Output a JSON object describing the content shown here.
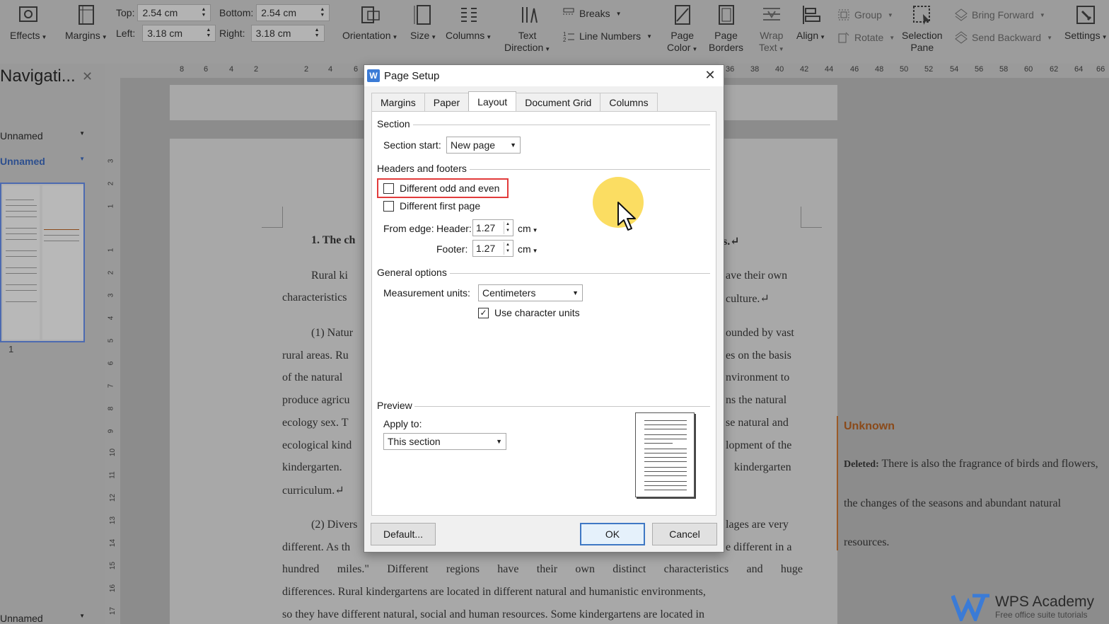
{
  "ribbon": {
    "effects": "Effects",
    "margins": "Margins",
    "top_label": "Top:",
    "top_value": "2.54 cm",
    "bottom_label": "Bottom:",
    "bottom_value": "2.54 cm",
    "left_label": "Left:",
    "left_value": "3.18 cm",
    "right_label": "Right:",
    "right_value": "3.18 cm",
    "orientation": "Orientation",
    "size": "Size",
    "columns": "Columns",
    "text_direction_1": "Text",
    "text_direction_2": "Direction",
    "breaks": "Breaks",
    "line_numbers": "Line Numbers",
    "page_color_1": "Page",
    "page_color_2": "Color",
    "page_borders_1": "Page",
    "page_borders_2": "Borders",
    "wrap_text_1": "Wrap",
    "wrap_text_2": "Text",
    "align": "Align",
    "group": "Group",
    "rotate": "Rotate",
    "selection_pane_1": "Selection",
    "selection_pane_2": "Pane",
    "bring_forward": "Bring Forward",
    "send_backward": "Send Backward",
    "settings": "Settings"
  },
  "ruler": {
    "left_ticks": [
      "8",
      "6",
      "4",
      "2",
      "2",
      "4",
      "6"
    ],
    "right_ticks": [
      "36",
      "38",
      "40",
      "42",
      "44",
      "46",
      "48",
      "50",
      "52",
      "54",
      "56",
      "58",
      "60",
      "62",
      "64",
      "66"
    ]
  },
  "vruler": {
    "ticks": [
      "3",
      "2",
      "1",
      "1",
      "2",
      "3",
      "4",
      "5",
      "6",
      "7",
      "8",
      "9",
      "10",
      "11",
      "12",
      "13",
      "14",
      "15",
      "16",
      "17"
    ]
  },
  "nav": {
    "title": "Navigati...",
    "items": [
      "Unnamed",
      "Unnamed"
    ],
    "bottom_item": "Unnamed",
    "page_number": "1"
  },
  "document": {
    "heading_left": "1. The ch",
    "heading_right": "s.↵",
    "lines_left": [
      "Rural ki",
      "characteristics",
      "(1) Natur",
      "rural areas. Ru",
      "of the natural",
      "produce agricu",
      "ecology sex. T",
      "ecological kind",
      "kindergarten.",
      "curriculum.↵",
      "(2) Divers",
      "different. As th"
    ],
    "lines_right": [
      "ave their own",
      "culture.↵",
      "ounded by vast",
      "es on the basis",
      "nvironment to",
      "ns the natural",
      "se natural and",
      "lopment of the",
      "kindergarten",
      "lages are very",
      "e different in a"
    ],
    "full_lines": [
      "hundred miles.\" Different regions have their own distinct characteristics and huge",
      "differences. Rural kindergartens are located in different natural and humanistic environments,",
      "so they have different natural, social and human resources. Some kindergartens are located in"
    ]
  },
  "comment": {
    "author": "Unknown",
    "deleted_label": "Deleted:",
    "text": "There is also the fragrance of birds and flowers, the changes of the seasons and abundant natural resources."
  },
  "watermark": {
    "brand": "WPS Academy",
    "tagline": "Free office suite tutorials"
  },
  "dialog": {
    "title": "Page Setup",
    "app_icon": "W",
    "tabs": [
      "Margins",
      "Paper",
      "Layout",
      "Document Grid",
      "Columns"
    ],
    "active_tab": "Layout",
    "section": {
      "label": "Section",
      "start_label": "Section start:",
      "start_value": "New page"
    },
    "headers_footers": {
      "label": "Headers and footers",
      "odd_even": "Different odd and even",
      "odd_even_checked": false,
      "first_page": "Different first page",
      "first_page_checked": false,
      "from_edge_label": "From edge:",
      "header_label": "Header:",
      "header_value": "1.27",
      "footer_label": "Footer:",
      "footer_value": "1.27",
      "unit": "cm"
    },
    "general": {
      "label": "General options",
      "units_label": "Measurement units:",
      "units_value": "Centimeters",
      "char_units": "Use character units",
      "char_units_checked": true
    },
    "preview": {
      "label": "Preview",
      "apply_label": "Apply to:",
      "apply_value": "This section"
    },
    "buttons": {
      "default": "Default...",
      "ok": "OK",
      "cancel": "Cancel"
    }
  },
  "colors": {
    "highlight": "#e23b3b",
    "primary_button": "#3f78c4",
    "cursor_glow": "#fad746",
    "comment_author": "#8a4a1a"
  }
}
